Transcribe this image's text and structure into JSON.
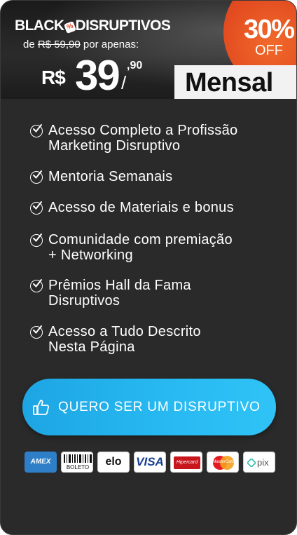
{
  "header": {
    "brand_left": "BLACK",
    "brand_right": "DISRUPTIVOS",
    "old_price_prefix": "de ",
    "old_price": "R$ 59,90",
    "old_price_suffix": " por apenas:",
    "currency": "R$",
    "price_int": "39",
    "price_slash": "/",
    "price_cents": ",90",
    "discount_pct": "30%",
    "discount_off": "OFF",
    "plan": "Mensal"
  },
  "features": [
    {
      "line1": "Acesso Completo a Profissão",
      "line2": "Marketing Disruptivo"
    },
    {
      "line1": "Mentoria Semanais",
      "line2": ""
    },
    {
      "line1": "Acesso de Materiais  e bonus",
      "line2": ""
    },
    {
      "line1": "Comunidade com premiação",
      "line2": "+ Networking"
    },
    {
      "line1": "Prêmios Hall da Fama",
      "line2": "Disruptivos"
    },
    {
      "line1": "Acesso a Tudo Descrito",
      "line2": "Nesta Página"
    }
  ],
  "cta": {
    "label": "QUERO SER UM DISRUPTIVO",
    "icon": "thumbs-up-icon"
  },
  "payments": {
    "amex": "AMEX",
    "boleto": "BOLETO",
    "elo": "elo",
    "visa": "VISA",
    "hipercard": "Hipercard",
    "mastercard": "MasterCard",
    "pix": "pix"
  },
  "colors": {
    "background": "#2a2a2a",
    "accent_orange": "#dd3f1c",
    "cta_blue": "#26b7f0"
  }
}
